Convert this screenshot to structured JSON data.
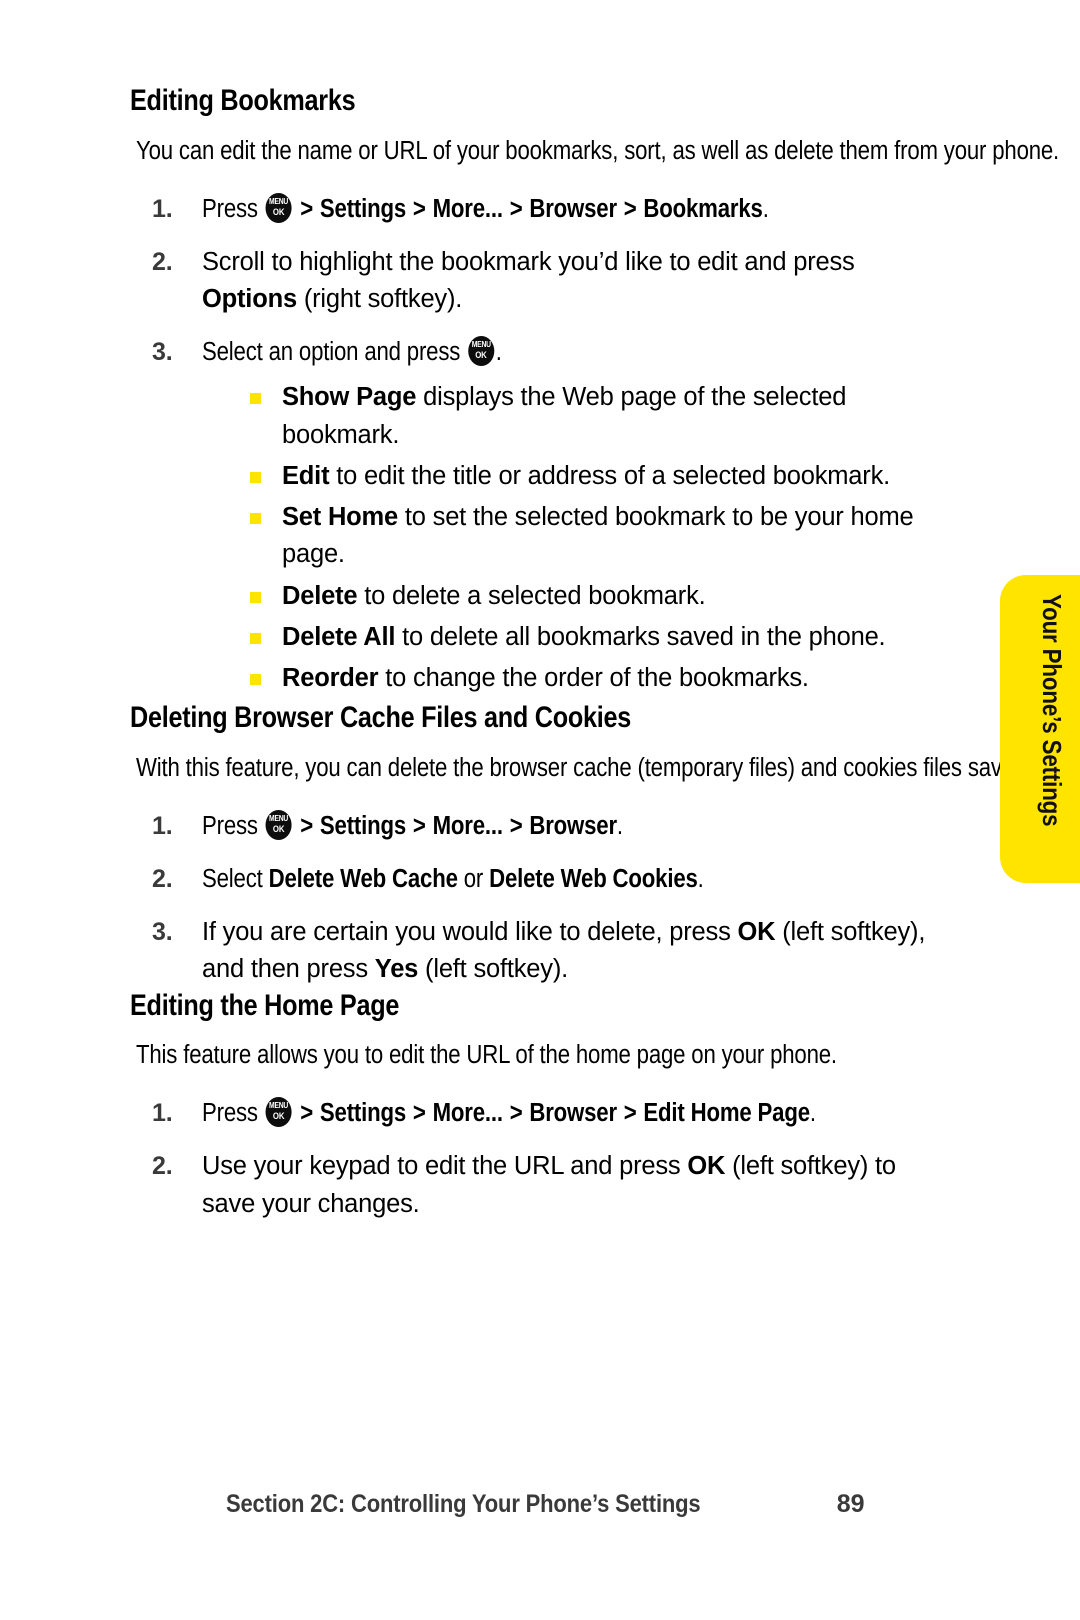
{
  "page": {
    "number": "89",
    "accent_yellow": "#FFE400",
    "text_color": "#000000",
    "muted_color": "#3A3A3A"
  },
  "side_tab": {
    "label": "Your Phone’s Settings"
  },
  "footer": {
    "title": "Section 2C: Controlling Your Phone’s Settings",
    "page_number": "89"
  },
  "menu_key": {
    "top_label": "MENU",
    "bottom_label": "OK",
    "icon_name": "menu-ok-key-icon"
  },
  "sections": [
    {
      "heading": "Editing Bookmarks",
      "intro": "You can edit the name or URL of your bookmarks, sort, as well as delete them from your phone.",
      "steps": [
        {
          "number": "1.",
          "prefix": "Press ",
          "has_menu_key": true,
          "path": [
            " > ",
            "Settings",
            " > ",
            "More...",
            " > ",
            "Browser",
            " > ",
            "Bookmarks"
          ],
          "suffix": "."
        },
        {
          "number": "2.",
          "text_before_bold": "Scroll to highlight the bookmark you’d like to edit and press ",
          "bold": "Options",
          "text_after_bold": " (right softkey)."
        },
        {
          "number": "3.",
          "text_before_bold": "Select an option and press ",
          "has_menu_key_end": true,
          "text_after_bold": "."
        }
      ],
      "bullets": [
        {
          "term": "Show Page",
          "description": " displays the Web page of the selected bookmark."
        },
        {
          "term": "Edit",
          "description": " to edit the title or address of a selected bookmark."
        },
        {
          "term": "Set Home",
          "description": " to set the selected bookmark to be your home page."
        },
        {
          "term": "Delete",
          "description": " to delete a selected bookmark."
        },
        {
          "term": "Delete All",
          "description": " to delete all bookmarks saved in the phone."
        },
        {
          "term": "Reorder",
          "description": " to change the order of the bookmarks."
        }
      ]
    },
    {
      "heading": "Deleting Browser Cache Files and Cookies",
      "intro": "With this feature, you can delete the browser cache (temporary files) and cookies files saved in the phone.",
      "steps": [
        {
          "number": "1.",
          "prefix": "Press ",
          "has_menu_key": true,
          "path": [
            " > ",
            "Settings",
            " > ",
            "More...",
            " > ",
            "Browser"
          ],
          "suffix": "."
        },
        {
          "number": "2.",
          "text_plain_1": "Select ",
          "bold_1": "Delete Web Cache",
          "text_plain_2": " or ",
          "bold_2": "Delete Web Cookies",
          "text_plain_3": "."
        },
        {
          "number": "3.",
          "text_plain_1": "If you are certain you would like to delete, press ",
          "bold_1": "OK",
          "text_plain_2": " (left softkey), and then press ",
          "bold_2": "Yes",
          "text_plain_3": " (left softkey)."
        }
      ]
    },
    {
      "heading": "Editing the Home Page",
      "intro": "This feature allows you to edit the URL of the home page on your phone.",
      "steps": [
        {
          "number": "1.",
          "prefix": "Press ",
          "has_menu_key": true,
          "path": [
            " > ",
            "Settings",
            " > ",
            "More...",
            " > ",
            "Browser",
            " > ",
            "Edit Home Page"
          ],
          "suffix": "."
        },
        {
          "number": "2.",
          "text_plain_1": "Use your keypad to edit the URL and press ",
          "bold_1": "OK",
          "text_plain_2": " (left softkey) to save your changes."
        }
      ]
    }
  ]
}
